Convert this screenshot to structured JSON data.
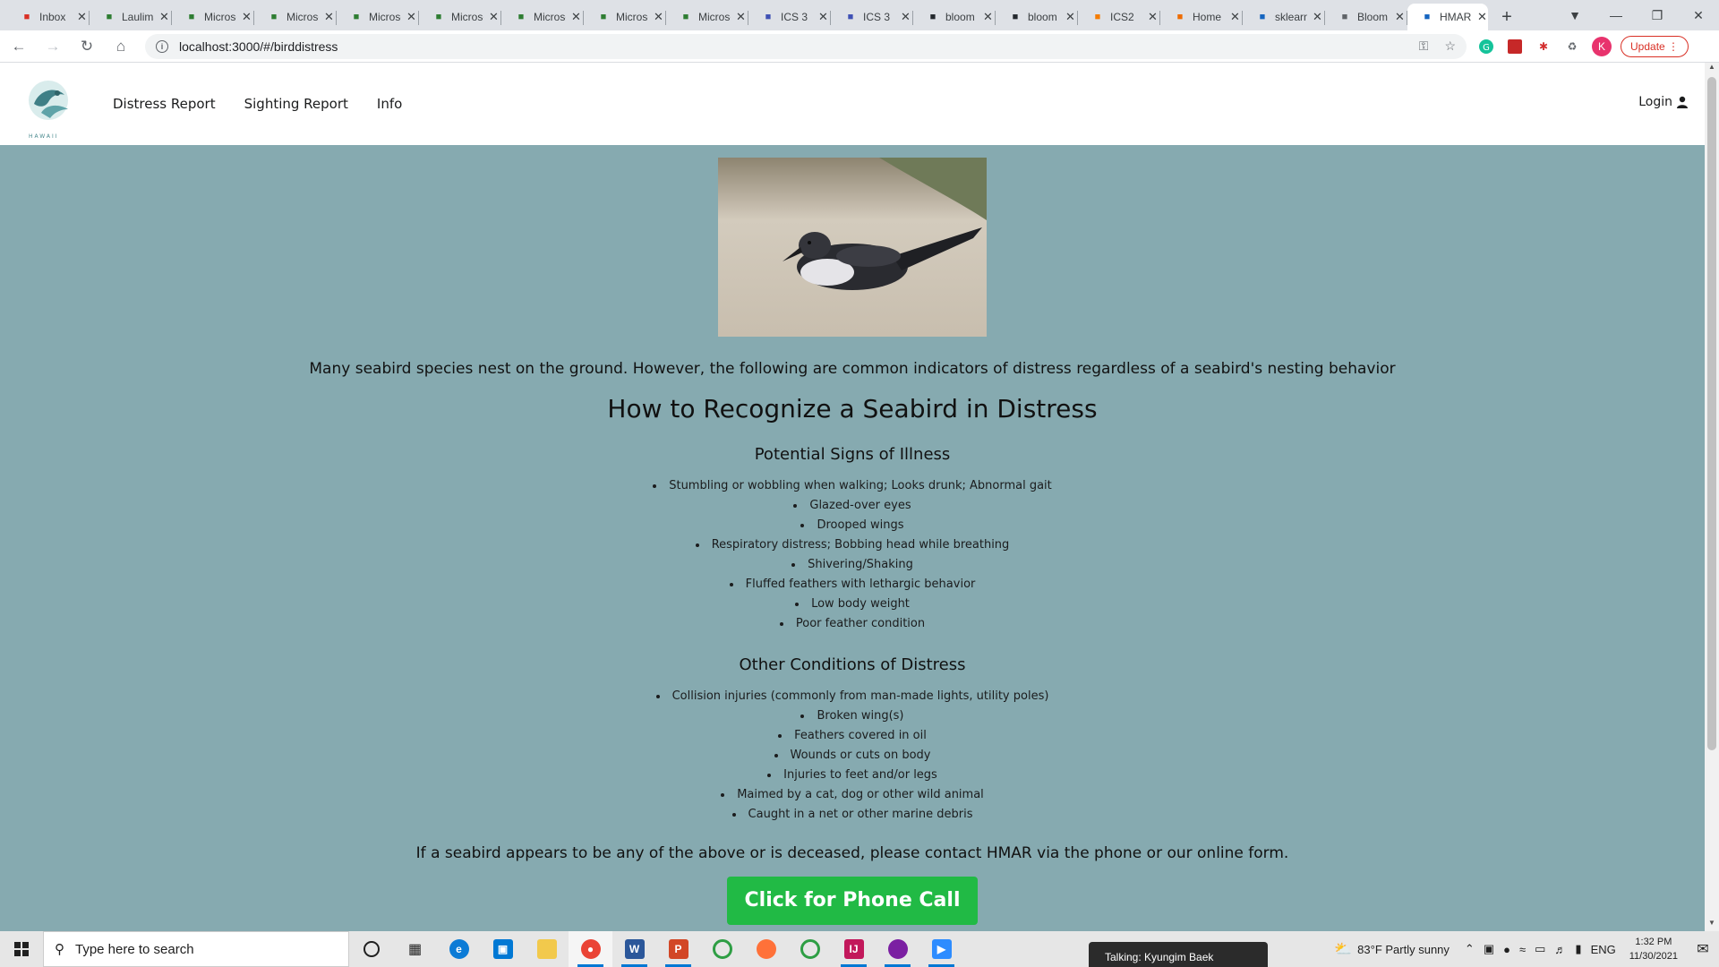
{
  "browser": {
    "tabs": [
      {
        "label": "Inbox",
        "icon": "gmail-icon",
        "color": "#d93025",
        "active": false
      },
      {
        "label": "Laulima",
        "icon": "leaf-icon",
        "color": "#2e7d32",
        "active": false
      },
      {
        "label": "Microsoft",
        "icon": "leaf-icon",
        "color": "#2e7d32",
        "active": false
      },
      {
        "label": "Microsoft",
        "icon": "leaf-icon",
        "color": "#2e7d32",
        "active": false
      },
      {
        "label": "Microsoft",
        "icon": "leaf-icon",
        "color": "#2e7d32",
        "active": false
      },
      {
        "label": "Microsoft",
        "icon": "leaf-icon",
        "color": "#2e7d32",
        "active": false
      },
      {
        "label": "Microsoft",
        "icon": "leaf-icon",
        "color": "#2e7d32",
        "active": false
      },
      {
        "label": "Microsoft",
        "icon": "leaf-icon",
        "color": "#2e7d32",
        "active": false
      },
      {
        "label": "Microsoft",
        "icon": "leaf-icon",
        "color": "#2e7d32",
        "active": false
      },
      {
        "label": "ICS 3",
        "icon": "square-icon",
        "color": "#3f51b5",
        "active": false
      },
      {
        "label": "ICS 3",
        "icon": "square-icon",
        "color": "#3f51b5",
        "active": false
      },
      {
        "label": "bloom",
        "icon": "github-icon",
        "color": "#24292e",
        "active": false
      },
      {
        "label": "bloom",
        "icon": "github-icon",
        "color": "#24292e",
        "active": false
      },
      {
        "label": "ICS2",
        "icon": "spinner-icon",
        "color": "#f57c00",
        "active": false
      },
      {
        "label": "Home",
        "icon": "book-icon",
        "color": "#ef6c00",
        "active": false
      },
      {
        "label": "sklearn",
        "icon": "chart-icon",
        "color": "#1565c0",
        "active": false
      },
      {
        "label": "Bloom",
        "icon": "globe-icon",
        "color": "#5f6368",
        "active": false
      },
      {
        "label": "HMAR",
        "icon": "page-icon",
        "color": "#1565c0",
        "active": true
      }
    ],
    "url": "localhost:3000/#/birddistress",
    "profile_initial": "K",
    "update_label": "Update"
  },
  "site": {
    "logo_text": "HAWAII",
    "nav": [
      {
        "label": "Distress Report"
      },
      {
        "label": "Sighting Report"
      },
      {
        "label": "Info"
      }
    ],
    "login_label": "Login"
  },
  "page": {
    "intro": "Many seabird species nest on the ground. However, the following are common indicators of distress regardless of a seabird's nesting behavior",
    "heading": "How to Recognize a Seabird in Distress",
    "illness_heading": "Potential Signs of Illness",
    "illness_items": [
      "Stumbling or wobbling when walking; Looks drunk; Abnormal gait",
      "Glazed-over eyes",
      "Drooped wings",
      "Respiratory distress; Bobbing head while breathing",
      "Shivering/Shaking",
      "Fluffed feathers with lethargic behavior",
      "Low body weight",
      "Poor feather condition"
    ],
    "other_heading": "Other Conditions of Distress",
    "other_items": [
      "Collision injuries (commonly from man-made lights, utility poles)",
      "Broken wing(s)",
      "Feathers covered in oil",
      "Wounds or cuts on body",
      "Injuries to feet and/or legs",
      "Maimed by a cat, dog or other wild animal",
      "Caught in a net or other marine debris"
    ],
    "contact": "If a seabird appears to be any of the above or is deceased, please contact HMAR via the phone or our online form.",
    "phone_button": "Click for Phone Call"
  },
  "taskbar": {
    "search_placeholder": "Type here to search",
    "media_text": "Talking: Kyungim Baek",
    "weather": "83°F  Partly sunny",
    "language": "ENG",
    "time": "1:32 PM",
    "date": "11/30/2021"
  }
}
